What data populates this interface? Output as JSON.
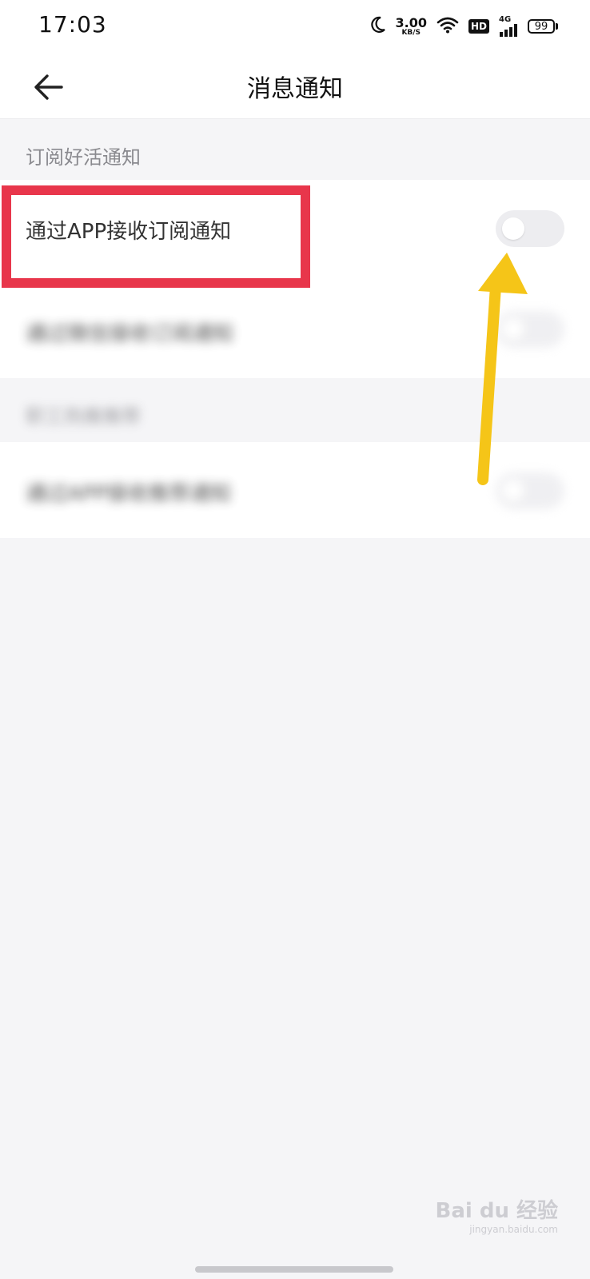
{
  "status_bar": {
    "time": "17:03",
    "speed_value": "3.00",
    "speed_unit": "KB/S",
    "hd_label": "HD",
    "network_type": "4G",
    "battery_level": "99"
  },
  "nav": {
    "title": "消息通知"
  },
  "sections": [
    {
      "header": "订阅好活通知",
      "rows": [
        {
          "label": "通过APP接收订阅通知",
          "switch_on": false
        },
        {
          "label": "通过微信接收订阅通知",
          "switch_on": false
        }
      ]
    },
    {
      "header": "职工热推推荐",
      "rows": [
        {
          "label": "通过APP接收推荐通知",
          "switch_on": false
        }
      ]
    }
  ],
  "annotation": {
    "highlight_color": "#e8364b",
    "arrow_color": "#f5c518"
  },
  "watermark": {
    "brand": "Bai du 经验",
    "domain": "jingyan.baidu.com"
  }
}
